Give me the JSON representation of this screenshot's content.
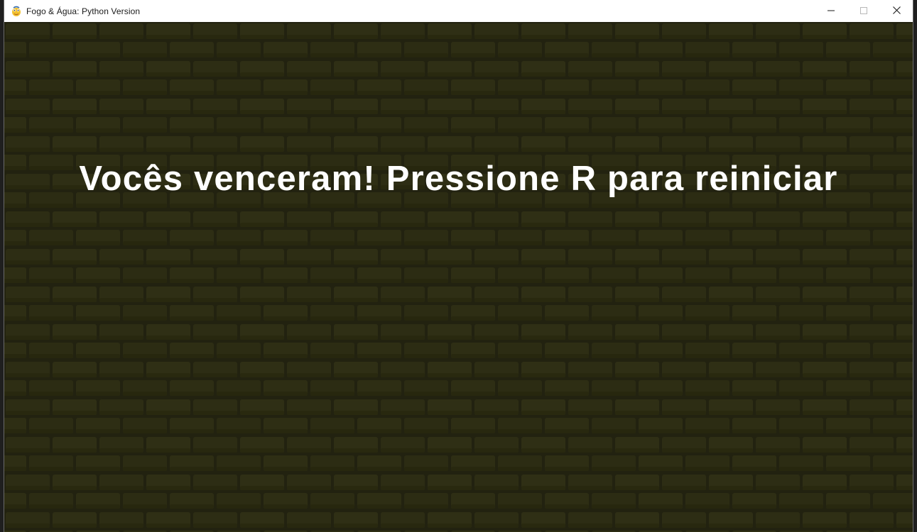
{
  "window": {
    "title": "Fogo & Água: Python Version",
    "icon": "pygame-snake-icon",
    "buttons": {
      "minimize": "minimize-icon",
      "maximize": "maximize-icon",
      "close": "close-icon"
    }
  },
  "game": {
    "message": "Vocês venceram! Pressione R para reiniciar",
    "background": "brick-wall",
    "colors": {
      "wall": "#2a2a12",
      "brick": "#2e2e14",
      "mortar": "#222210",
      "text": "#ffffff"
    }
  }
}
